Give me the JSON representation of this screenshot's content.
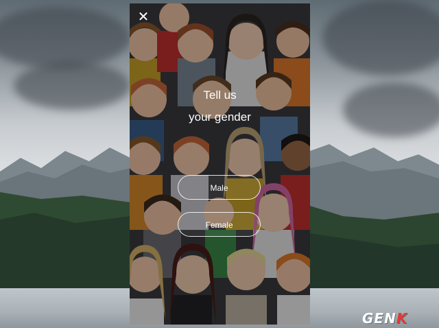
{
  "dialog": {
    "title_line1": "Tell us",
    "title_line2": "your gender",
    "options": [
      "Male",
      "Female"
    ]
  },
  "icons": {
    "close": "close-icon"
  },
  "watermark": {
    "text_main": "GEN",
    "text_accent": "K"
  },
  "colors": {
    "overlay": "#000000",
    "button_border": "#ffffff",
    "text": "#ffffff",
    "watermark_accent": "#e53935"
  }
}
